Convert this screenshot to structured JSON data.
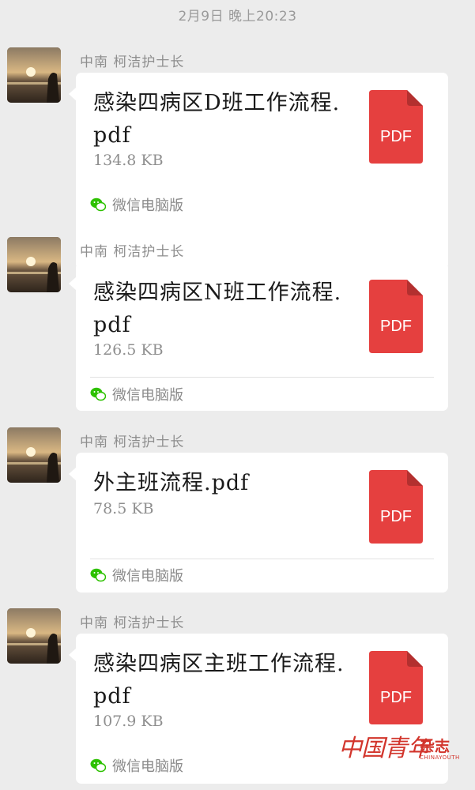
{
  "timestamp": "2月9日 晚上20:23",
  "messages": [
    {
      "sender": "中南 柯洁护士长",
      "file_name": "感染四病区D班工作流程.pdf",
      "file_size": "134.8 KB",
      "file_type_label": "PDF",
      "source_label": "微信电脑版",
      "avatar_icon": "avatar-sunset-photo"
    },
    {
      "sender": "中南 柯洁护士长",
      "file_name": "感染四病区N班工作流程.pdf",
      "file_size": "126.5 KB",
      "file_type_label": "PDF",
      "source_label": "微信电脑版",
      "avatar_icon": "avatar-sunset-photo"
    },
    {
      "sender": "中南 柯洁护士长",
      "file_name": "外主班流程.pdf",
      "file_size": "78.5 KB",
      "file_type_label": "PDF",
      "source_label": "微信电脑版",
      "avatar_icon": "avatar-sunset-photo"
    },
    {
      "sender": "中南 柯洁护士长",
      "file_name": "感染四病区主班工作流程.pdf",
      "file_size": "107.9 KB",
      "file_type_label": "PDF",
      "source_label": "微信电脑版",
      "avatar_icon": "avatar-sunset-photo"
    }
  ],
  "watermark": {
    "main": "中国青年",
    "side": "杂志",
    "english": "CHINAYOUTH"
  },
  "colors": {
    "background": "#ececec",
    "card": "#ffffff",
    "pdf_red": "#e5403f",
    "pdf_fold": "#b3302f",
    "wechat_green": "#2dc100",
    "watermark_red": "#d2352c"
  }
}
